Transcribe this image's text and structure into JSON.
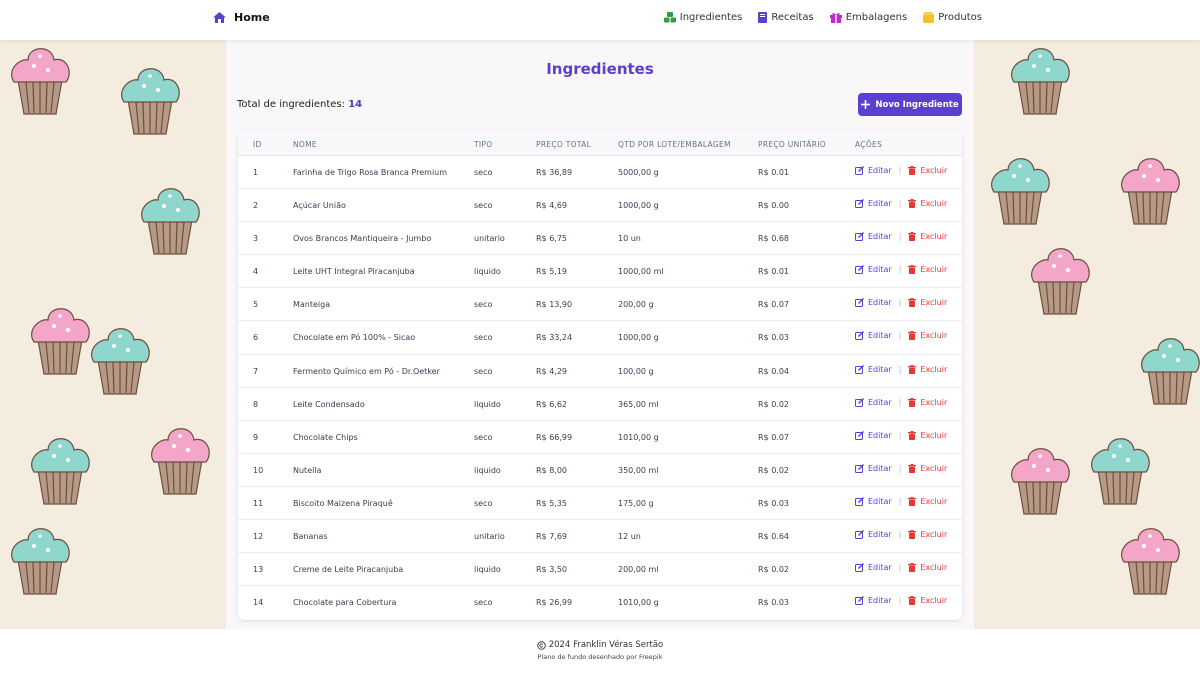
{
  "navbar": {
    "brand_label": "Home",
    "links": [
      {
        "label": "Ingredientes",
        "icon": "cubes-icon",
        "color": "#2e9e44"
      },
      {
        "label": "Receitas",
        "icon": "book-icon",
        "color": "#5b3fd3"
      },
      {
        "label": "Embalagens",
        "icon": "gift-icon",
        "color": "#c026d3"
      },
      {
        "label": "Produtos",
        "icon": "box-icon",
        "color": "#f6c026"
      }
    ]
  },
  "page": {
    "title": "Ingredientes",
    "total_label": "Total de ingredientes:",
    "total_value": "14",
    "new_button": "Novo Ingrediente",
    "accent": "#5b3fd3",
    "danger": "#e53935"
  },
  "table": {
    "headers": [
      "ID",
      "NOME",
      "TIPO",
      "PREÇO TOTAL",
      "QTD POR LOTE/EMBALAGEM",
      "PREÇO UNITÁRIO",
      "AÇÕES"
    ],
    "edit_label": "Editar",
    "delete_label": "Excluir",
    "separator": "|",
    "rows": [
      {
        "id": "1",
        "nome": "Farinha de Trigo Rosa Branca Premium",
        "tipo": "seco",
        "preco": "R$ 36,89",
        "qtd": "5000,00 g",
        "unit": "R$ 0.01"
      },
      {
        "id": "2",
        "nome": "Açúcar União",
        "tipo": "seco",
        "preco": "R$ 4,69",
        "qtd": "1000,00 g",
        "unit": "R$ 0.00"
      },
      {
        "id": "3",
        "nome": "Ovos Brancos Mantiqueira - Jumbo",
        "tipo": "unitario",
        "preco": "R$ 6,75",
        "qtd": "10 un",
        "unit": "R$ 0.68"
      },
      {
        "id": "4",
        "nome": "Leite UHT Integral Piracanjuba",
        "tipo": "liquido",
        "preco": "R$ 5,19",
        "qtd": "1000,00 ml",
        "unit": "R$ 0.01"
      },
      {
        "id": "5",
        "nome": "Manteiga",
        "tipo": "seco",
        "preco": "R$ 13,90",
        "qtd": "200,00 g",
        "unit": "R$ 0.07"
      },
      {
        "id": "6",
        "nome": "Chocolate em Pó 100% - Sicao",
        "tipo": "seco",
        "preco": "R$ 33,24",
        "qtd": "1000,00 g",
        "unit": "R$ 0.03"
      },
      {
        "id": "7",
        "nome": "Fermento Químico em Pó - Dr.Oetker",
        "tipo": "seco",
        "preco": "R$ 4,29",
        "qtd": "100,00 g",
        "unit": "R$ 0.04"
      },
      {
        "id": "8",
        "nome": "Leite Condensado",
        "tipo": "liquido",
        "preco": "R$ 6,62",
        "qtd": "365,00 ml",
        "unit": "R$ 0.02"
      },
      {
        "id": "9",
        "nome": "Chocolate Chips",
        "tipo": "seco",
        "preco": "R$ 66,99",
        "qtd": "1010,00 g",
        "unit": "R$ 0.07"
      },
      {
        "id": "10",
        "nome": "Nutella",
        "tipo": "liquido",
        "preco": "R$ 8,00",
        "qtd": "350,00 ml",
        "unit": "R$ 0.02"
      },
      {
        "id": "11",
        "nome": "Biscoito Maizena Piraquê",
        "tipo": "seco",
        "preco": "R$ 5,35",
        "qtd": "175,00 g",
        "unit": "R$ 0.03"
      },
      {
        "id": "12",
        "nome": "Bananas",
        "tipo": "unitario",
        "preco": "R$ 7,69",
        "qtd": "12 un",
        "unit": "R$ 0.64"
      },
      {
        "id": "13",
        "nome": "Creme de Leite Piracanjuba",
        "tipo": "liquido",
        "preco": "R$ 3,50",
        "qtd": "200,00 ml",
        "unit": "R$ 0.02"
      },
      {
        "id": "14",
        "nome": "Chocolate para Cobertura",
        "tipo": "seco",
        "preco": "R$ 26,99",
        "qtd": "1010,00 g",
        "unit": "R$ 0.03"
      }
    ]
  },
  "footer": {
    "copyright": "2024 Franklin Véras Sertão",
    "credit": "Plano de fundo desenhado por Freepik"
  }
}
